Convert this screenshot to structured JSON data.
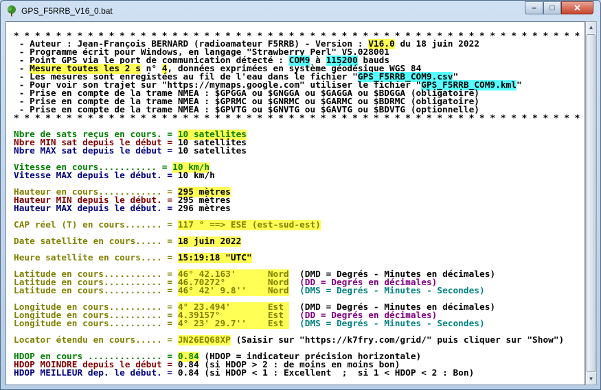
{
  "window": {
    "title": "GPS_F5RRB_V16_0.bat",
    "min": "–",
    "max": "□",
    "close": "✕",
    "icon": "tree-icon"
  },
  "header": {
    "stars": "* * * * * * * * * * * * * * * * * * * * * * * * * * * * * * * * * * * * * * * * * * * * * * * * * * * * * * * * * * * * * * * * * * * * * * * * * *",
    "l1a": " - Auteur : Jean-François BERNARD (radioamateur F5RRB) - Version : ",
    "version": "V16.0",
    "l1b": " du 18 juin 2022",
    "l2": " - Programme écrit pour Windows, en langage \"Strawberry Perl\" V5.028001",
    "l3a": " - Point GPS via le port de communication détecté : ",
    "port": "COM9",
    "l3b": " à ",
    "baud": "115200",
    "l3c": " bauds",
    "l4a": " - ",
    "mesure": "Mesure toutes les 2 s",
    "l4b": " n° ",
    "num": "4",
    "l4c": ", données exprimées en système géodésique WGS 84",
    "l5a": " - Les mesures sont enregistées au fil de l'eau dans le fichier \"",
    "csv": "GPS_F5RRB_COM9.csv",
    "l5b": "\"",
    "l6a": " - Pour voir son trajet sur \"https://mymaps.google.com\" utiliser le fichier \"",
    "kml": "GPS_F5RRB_COM9.kml",
    "l6b": "\"",
    "l7": " - Prise en compte de la trame NMEA : $GPGGA ou $GNGGA ou $GAGGA ou $BDGGA (obligatoire)",
    "l8": " - Prise en compte de la trame NMEA : $GPRMC ou $GNRMC ou $GARMC ou $BDRMC (obligatoire)",
    "l9": " - Prise en compte de la trame NMEA : $GPVTG ou $GNVTG ou $GAVTG ou $BDVTG (optionnelle)"
  },
  "sats": {
    "cur_label": "Nbre de sats reçus en cours. = ",
    "cur": "10 satellites",
    "min_label": "Nbre MIN sat depuis le début = ",
    "min": "10 satellites",
    "max_label": "Nbre MAX sat depuis le début = ",
    "max": "10 satellites"
  },
  "speed": {
    "cur_label": "Vitesse en cours........... = ",
    "cur": "10 km/h",
    "max_label": "Vitesse MAX depuis le début. = ",
    "max": "10 km/h"
  },
  "height": {
    "cur_label": "Hauteur en cours............ = ",
    "cur": "295 mètres",
    "min_label": "Hauteur MIN depuis le début. = ",
    "min": "295 mètres",
    "max_label": "Hauteur MAX depuis le début. = ",
    "max": "296 mètres"
  },
  "cap": {
    "label": "CAP réel (T) en cours....... = ",
    "value": "117 ° ==> ESE (est-sud-est)"
  },
  "date": {
    "label": "Date satellite en cours..... = ",
    "value": "18 juin 2022"
  },
  "time": {
    "label": "Heure satellite en cours.... = ",
    "value": "15:19:18 \"UTC\""
  },
  "latitude": {
    "label": "Latitude en cours........... = ",
    "dmd": "46° 42.163'      Nord",
    "dmd_note": "  (DMD = Degrés - Minutes en décimales)",
    "dd": "46.70272°        Nord",
    "dd_note": "  (DD = Degrés en décimales)",
    "dms": "46° 42' 9.8''    Nord",
    "dms_note": "  (DMS = Degrés - Minutes - Secondes)"
  },
  "longitude": {
    "label": "Longitude en cours.......... = ",
    "dmd": "4° 23.494'       Est ",
    "dmd_note": "  (DMD = Degrés - Minutes en décimales)",
    "dd": "4.39157°         Est ",
    "dd_note": "  (DD = Degrés en décimales)",
    "dms": "4° 23' 29.7''    Est ",
    "dms_note": "  (DMS = Degrés - Minutes - Secondes)"
  },
  "locator": {
    "label": "Locator étendu en cours..... = ",
    "value": "JN26EQ68XP",
    "note": " (Saisir sur \"https://k7fry.com/grid/\" puis cliquer sur \"Show\")"
  },
  "hdop": {
    "cur_label": "HDOP en cours .............. = ",
    "cur": "0.84",
    "cur_note": " (HDOP = indicateur précision horizontale)",
    "min_label": "HDOP MOINDRE depuis le début = ",
    "min": "0.84",
    "min_note": " (si HDOP > 2 : de moins en moins bon)",
    "best_label": "HDOP MEILLEUR dep. le début. = ",
    "best": "0.84",
    "best_note": " (si HDOP < 1 : Excellent  ;  si 1 < HDOP < 2 : Bon)"
  }
}
